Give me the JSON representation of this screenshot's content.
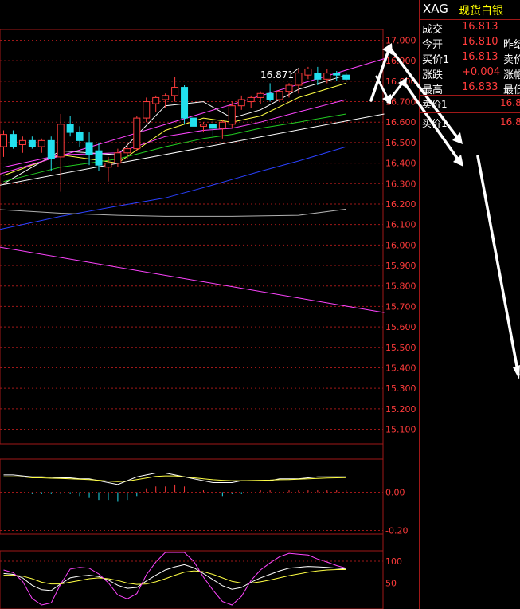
{
  "quote": {
    "code": "XAG",
    "name": "现货白银",
    "rows": [
      {
        "label": "成交",
        "value": "16.813",
        "label2": ""
      },
      {
        "label": "今开",
        "value": "16.810",
        "label2": "昨结"
      },
      {
        "label": "买价1",
        "value": "16.813",
        "label2": "卖价"
      },
      {
        "label": "涨跌",
        "value": "+0.004",
        "label2": "涨幅"
      },
      {
        "label": "最高",
        "value": "16.833",
        "label2": "最低"
      }
    ],
    "book": [
      {
        "label": "卖价1",
        "value": "16.8"
      },
      {
        "label": "买价1",
        "value": "16.8"
      }
    ]
  },
  "main_chart": {
    "price_axis": [
      "17.000",
      "16.900",
      "16.800",
      "16.700",
      "16.600",
      "16.500",
      "16.400",
      "16.300",
      "16.200",
      "16.100",
      "16.000",
      "15.900",
      "15.800",
      "15.700",
      "15.600",
      "15.500",
      "15.400",
      "15.300",
      "15.200",
      "15.100"
    ],
    "high_marker": "16.871",
    "colors": {
      "up": "#ff3b3b",
      "down": "#22e0ee",
      "grid": "#a01818",
      "axis_text": "#ff3b3b"
    }
  },
  "macd_panel": {
    "axis": [
      "0.00",
      "-0.20"
    ]
  },
  "kdj_panel": {
    "axis": [
      "100",
      "50"
    ]
  },
  "chart_data": [
    {
      "type": "candlestick",
      "ylim": [
        15.05,
        17.04
      ],
      "grid": true,
      "y_ticks": [
        17.0,
        16.9,
        16.8,
        16.7,
        16.6,
        16.5,
        16.4,
        16.3,
        16.2,
        16.1,
        16.0,
        15.9,
        15.8,
        15.7,
        15.6,
        15.5,
        15.4,
        15.3,
        15.2,
        15.1
      ],
      "annotations": [
        {
          "text": "16.871",
          "value": 16.871
        }
      ],
      "candles": [
        {
          "o": 16.48,
          "h": 16.56,
          "l": 16.43,
          "c": 16.54
        },
        {
          "o": 16.54,
          "h": 16.56,
          "l": 16.47,
          "c": 16.48
        },
        {
          "o": 16.49,
          "h": 16.53,
          "l": 16.45,
          "c": 16.51
        },
        {
          "o": 16.51,
          "h": 16.53,
          "l": 16.47,
          "c": 16.48
        },
        {
          "o": 16.48,
          "h": 16.52,
          "l": 16.45,
          "c": 16.51
        },
        {
          "o": 16.51,
          "h": 16.53,
          "l": 16.36,
          "c": 16.42
        },
        {
          "o": 16.43,
          "h": 16.64,
          "l": 16.26,
          "c": 16.59
        },
        {
          "o": 16.59,
          "h": 16.63,
          "l": 16.53,
          "c": 16.55
        },
        {
          "o": 16.55,
          "h": 16.58,
          "l": 16.48,
          "c": 16.51
        },
        {
          "o": 16.5,
          "h": 16.55,
          "l": 16.39,
          "c": 16.44
        },
        {
          "o": 16.46,
          "h": 16.5,
          "l": 16.36,
          "c": 16.39
        },
        {
          "o": 16.38,
          "h": 16.43,
          "l": 16.31,
          "c": 16.4
        },
        {
          "o": 16.4,
          "h": 16.47,
          "l": 16.38,
          "c": 16.45
        },
        {
          "o": 16.45,
          "h": 16.49,
          "l": 16.42,
          "c": 16.47
        },
        {
          "o": 16.47,
          "h": 16.63,
          "l": 16.46,
          "c": 16.62
        },
        {
          "o": 16.62,
          "h": 16.72,
          "l": 16.6,
          "c": 16.7
        },
        {
          "o": 16.69,
          "h": 16.73,
          "l": 16.65,
          "c": 16.72
        },
        {
          "o": 16.71,
          "h": 16.74,
          "l": 16.67,
          "c": 16.73
        },
        {
          "o": 16.73,
          "h": 16.82,
          "l": 16.7,
          "c": 16.77
        },
        {
          "o": 16.77,
          "h": 16.78,
          "l": 16.59,
          "c": 16.62
        },
        {
          "o": 16.62,
          "h": 16.64,
          "l": 16.56,
          "c": 16.58
        },
        {
          "o": 16.58,
          "h": 16.6,
          "l": 16.55,
          "c": 16.59
        },
        {
          "o": 16.59,
          "h": 16.61,
          "l": 16.53,
          "c": 16.57
        },
        {
          "o": 16.57,
          "h": 16.61,
          "l": 16.52,
          "c": 16.6
        },
        {
          "o": 16.59,
          "h": 16.7,
          "l": 16.57,
          "c": 16.68
        },
        {
          "o": 16.68,
          "h": 16.73,
          "l": 16.66,
          "c": 16.71
        },
        {
          "o": 16.7,
          "h": 16.73,
          "l": 16.67,
          "c": 16.72
        },
        {
          "o": 16.72,
          "h": 16.75,
          "l": 16.69,
          "c": 16.74
        },
        {
          "o": 16.74,
          "h": 16.79,
          "l": 16.7,
          "c": 16.71
        },
        {
          "o": 16.71,
          "h": 16.76,
          "l": 16.7,
          "c": 16.75
        },
        {
          "o": 16.75,
          "h": 16.79,
          "l": 16.72,
          "c": 16.78
        },
        {
          "o": 16.78,
          "h": 16.86,
          "l": 16.74,
          "c": 16.84
        },
        {
          "o": 16.83,
          "h": 16.87,
          "l": 16.81,
          "c": 16.86
        },
        {
          "o": 16.84,
          "h": 16.87,
          "l": 16.78,
          "c": 16.81
        },
        {
          "o": 16.81,
          "h": 16.86,
          "l": 16.79,
          "c": 16.84
        },
        {
          "o": 16.84,
          "h": 16.85,
          "l": 16.8,
          "c": 16.83
        },
        {
          "o": 16.83,
          "h": 16.84,
          "l": 16.8,
          "c": 16.81
        }
      ],
      "overlay_lines": [
        {
          "color": "#ffffff",
          "points": [
            [
              0,
              16.3
            ],
            [
              6,
              16.46
            ],
            [
              12,
              16.44
            ],
            [
              17,
              16.68
            ],
            [
              21,
              16.7
            ],
            [
              24,
              16.62
            ],
            [
              27,
              16.66
            ],
            [
              31,
              16.76
            ],
            [
              36,
              16.83
            ]
          ]
        },
        {
          "color": "#ffff44",
          "points": [
            [
              0,
              16.34
            ],
            [
              6,
              16.44
            ],
            [
              12,
              16.4
            ],
            [
              17,
              16.56
            ],
            [
              21,
              16.62
            ],
            [
              24,
              16.6
            ],
            [
              27,
              16.63
            ],
            [
              31,
              16.72
            ],
            [
              36,
              16.79
            ]
          ]
        },
        {
          "color": "#ff44ff",
          "points": [
            [
              0,
              16.38
            ],
            [
              6,
              16.44
            ],
            [
              12,
              16.45
            ],
            [
              17,
              16.53
            ],
            [
              21,
              16.56
            ],
            [
              24,
              16.57
            ],
            [
              27,
              16.6
            ],
            [
              31,
              16.65
            ],
            [
              36,
              16.71
            ]
          ]
        },
        {
          "color": "#22cc22",
          "points": [
            [
              0,
              16.31
            ],
            [
              6,
              16.38
            ],
            [
              12,
              16.42
            ],
            [
              17,
              16.48
            ],
            [
              21,
              16.52
            ],
            [
              24,
              16.54
            ],
            [
              27,
              16.57
            ],
            [
              31,
              16.6
            ],
            [
              36,
              16.64
            ]
          ]
        },
        {
          "color": "#2a40ff",
          "points": [
            [
              -3,
              16.05
            ],
            [
              6,
              16.14
            ],
            [
              12,
              16.19
            ],
            [
              17,
              16.23
            ],
            [
              21,
              16.28
            ],
            [
              24,
              16.32
            ],
            [
              27,
              16.36
            ],
            [
              31,
              16.41
            ],
            [
              36,
              16.48
            ]
          ]
        },
        {
          "color": "#b0b0b0",
          "points": [
            [
              -3,
              16.18
            ],
            [
              6,
              16.155
            ],
            [
              12,
              16.145
            ],
            [
              17,
              16.14
            ],
            [
              24,
              16.14
            ],
            [
              31,
              16.145
            ],
            [
              36,
              16.175
            ]
          ]
        },
        {
          "color": "#ff44ff",
          "points": [
            [
              -3,
              16.01
            ],
            [
              40,
              15.67
            ]
          ]
        },
        {
          "color": "#ff44ff",
          "points": [
            [
              -3,
              16.31
            ],
            [
              40,
              16.91
            ]
          ]
        },
        {
          "color": "#ffffff",
          "points": [
            [
              -3,
              16.27
            ],
            [
              40,
              16.64
            ]
          ]
        }
      ]
    },
    {
      "type": "macd",
      "ylim": [
        -0.22,
        0.12
      ],
      "y_ticks": [
        0.0,
        -0.2
      ],
      "hist": [
        0.0,
        0.0,
        0.0,
        -0.01,
        -0.01,
        -0.01,
        -0.01,
        -0.01,
        -0.02,
        -0.03,
        -0.04,
        -0.04,
        -0.05,
        -0.04,
        -0.02,
        0.02,
        0.03,
        0.03,
        0.04,
        0.03,
        0.02,
        0.01,
        -0.01,
        -0.02,
        -0.01,
        -0.01,
        0.0,
        0.01,
        0.01,
        0.0,
        0.01,
        0.01,
        0.01,
        0.01,
        0.01,
        0.01,
        0.01
      ],
      "dif": [
        0.09,
        0.09,
        0.085,
        0.08,
        0.08,
        0.078,
        0.075,
        0.075,
        0.07,
        0.07,
        0.06,
        0.05,
        0.04,
        0.06,
        0.08,
        0.09,
        0.1,
        0.1,
        0.09,
        0.08,
        0.07,
        0.06,
        0.05,
        0.05,
        0.05,
        0.06,
        0.06,
        0.06,
        0.06,
        0.07,
        0.07,
        0.07,
        0.075,
        0.08,
        0.08,
        0.08,
        0.08
      ],
      "dea": [
        0.08,
        0.08,
        0.08,
        0.075,
        0.075,
        0.073,
        0.072,
        0.07,
        0.068,
        0.066,
        0.062,
        0.058,
        0.055,
        0.058,
        0.066,
        0.074,
        0.082,
        0.085,
        0.085,
        0.08,
        0.075,
        0.07,
        0.065,
        0.062,
        0.06,
        0.06,
        0.061,
        0.062,
        0.063,
        0.065,
        0.066,
        0.068,
        0.07,
        0.072,
        0.074,
        0.075,
        0.076
      ]
    },
    {
      "type": "kdj",
      "ylim": [
        0,
        120
      ],
      "y_ticks": [
        100,
        50
      ],
      "k": [
        72,
        70,
        62,
        45,
        35,
        33,
        48,
        62,
        66,
        68,
        65,
        57,
        45,
        38,
        40,
        55,
        68,
        80,
        87,
        92,
        85,
        72,
        58,
        44,
        36,
        40,
        52,
        62,
        70,
        78,
        84,
        86,
        88,
        87,
        86,
        84,
        82
      ],
      "d": [
        68,
        68,
        66,
        60,
        52,
        48,
        48,
        52,
        56,
        60,
        62,
        60,
        56,
        50,
        47,
        48,
        53,
        60,
        68,
        75,
        78,
        76,
        70,
        62,
        54,
        50,
        50,
        53,
        57,
        62,
        67,
        71,
        75,
        78,
        80,
        81,
        81
      ],
      "j": [
        80,
        74,
        54,
        15,
        0,
        5,
        48,
        82,
        86,
        84,
        71,
        51,
        23,
        14,
        26,
        69,
        98,
        120,
        125,
        126,
        99,
        64,
        34,
        8,
        0,
        20,
        56,
        80,
        96,
        110,
        118,
        116,
        114,
        105,
        98,
        90,
        84
      ]
    }
  ]
}
